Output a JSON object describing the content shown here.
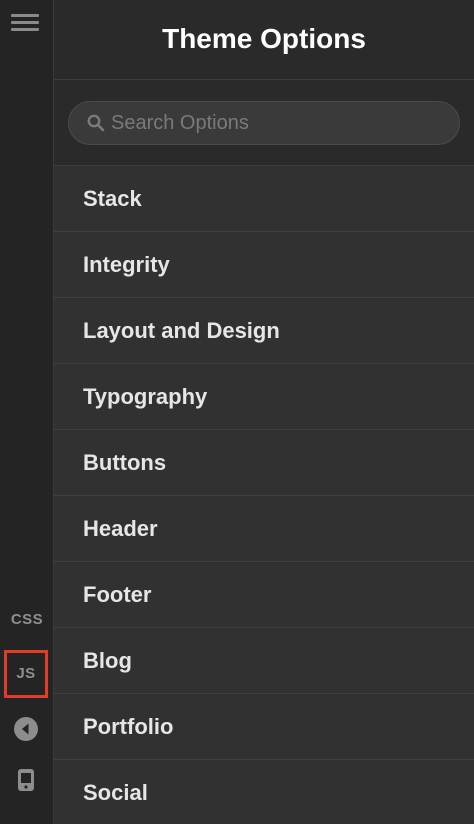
{
  "header": {
    "title": "Theme Options"
  },
  "search": {
    "placeholder": "Search Options"
  },
  "rail": {
    "css_label": "CSS",
    "js_label": "JS"
  },
  "menu": {
    "items": [
      {
        "label": "Stack"
      },
      {
        "label": "Integrity"
      },
      {
        "label": "Layout and Design"
      },
      {
        "label": "Typography"
      },
      {
        "label": "Buttons"
      },
      {
        "label": "Header"
      },
      {
        "label": "Footer"
      },
      {
        "label": "Blog"
      },
      {
        "label": "Portfolio"
      },
      {
        "label": "Social"
      }
    ]
  },
  "colors": {
    "rail_bg": "#242424",
    "panel_bg": "#2f2f2f",
    "highlight": "#e03c28",
    "text": "#e6e6e6"
  }
}
